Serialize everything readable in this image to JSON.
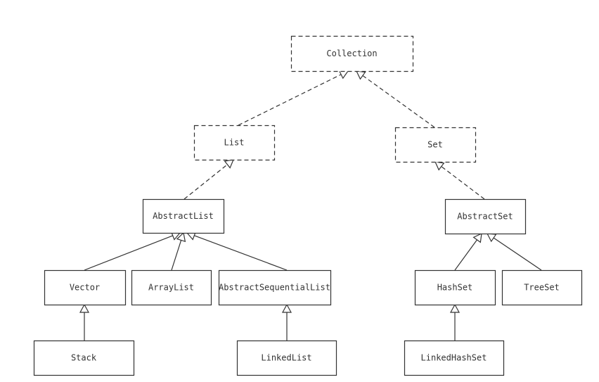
{
  "diagram": {
    "title": "",
    "colors": {
      "stroke": "#333333",
      "text": "#333333",
      "background": "#ffffff"
    },
    "nodes": [
      {
        "id": "collection",
        "label": "Collection",
        "kind": "interface"
      },
      {
        "id": "list",
        "label": "List",
        "kind": "interface"
      },
      {
        "id": "set",
        "label": "Set",
        "kind": "interface"
      },
      {
        "id": "abstractlist",
        "label": "AbstractList",
        "kind": "class"
      },
      {
        "id": "abstractset",
        "label": "AbstractSet",
        "kind": "class"
      },
      {
        "id": "vector",
        "label": "Vector",
        "kind": "class"
      },
      {
        "id": "arraylist",
        "label": "ArrayList",
        "kind": "class"
      },
      {
        "id": "abstractsequentiallist",
        "label": "AbstractSequentialList",
        "kind": "class"
      },
      {
        "id": "hashset",
        "label": "HashSet",
        "kind": "class"
      },
      {
        "id": "treeset",
        "label": "TreeSet",
        "kind": "class"
      },
      {
        "id": "stack",
        "label": "Stack",
        "kind": "class"
      },
      {
        "id": "linkedlist",
        "label": "LinkedList",
        "kind": "class"
      },
      {
        "id": "linkedhashset",
        "label": "LinkedHashSet",
        "kind": "class"
      }
    ],
    "edges": [
      {
        "from": "list",
        "to": "collection",
        "type": "realization"
      },
      {
        "from": "set",
        "to": "collection",
        "type": "realization"
      },
      {
        "from": "abstractlist",
        "to": "list",
        "type": "realization"
      },
      {
        "from": "abstractset",
        "to": "set",
        "type": "realization"
      },
      {
        "from": "vector",
        "to": "abstractlist",
        "type": "generalization"
      },
      {
        "from": "arraylist",
        "to": "abstractlist",
        "type": "generalization"
      },
      {
        "from": "abstractsequentiallist",
        "to": "abstractlist",
        "type": "generalization"
      },
      {
        "from": "hashset",
        "to": "abstractset",
        "type": "generalization"
      },
      {
        "from": "treeset",
        "to": "abstractset",
        "type": "generalization"
      },
      {
        "from": "stack",
        "to": "vector",
        "type": "generalization"
      },
      {
        "from": "linkedlist",
        "to": "abstractsequentiallist",
        "type": "generalization"
      },
      {
        "from": "linkedhashset",
        "to": "hashset",
        "type": "generalization"
      }
    ]
  }
}
